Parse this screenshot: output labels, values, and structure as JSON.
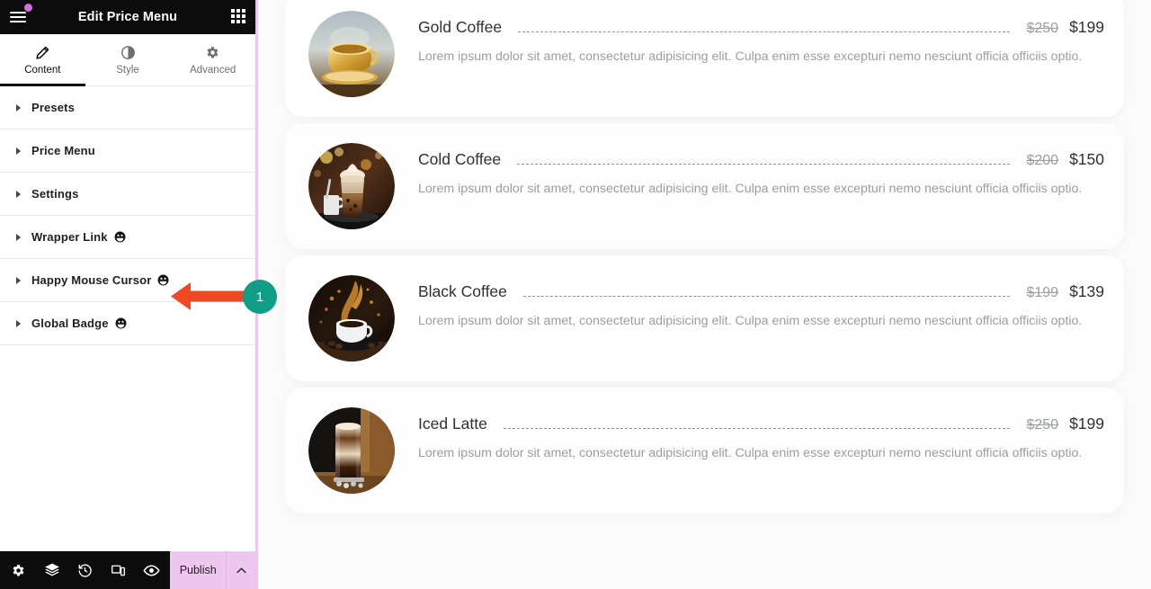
{
  "panel": {
    "header": {
      "title": "Edit Price Menu",
      "menu_icon": "hamburger-icon",
      "notification_dot": true,
      "widgets_icon": "grid-apps-icon"
    },
    "tabs": [
      {
        "label": "Content",
        "icon": "pencil-icon",
        "active": true
      },
      {
        "label": "Style",
        "icon": "contrast-half-circle-icon",
        "active": false
      },
      {
        "label": "Advanced",
        "icon": "gear-icon",
        "active": false
      }
    ],
    "sections": [
      {
        "label": "Presets",
        "pro": false
      },
      {
        "label": "Price Menu",
        "pro": false
      },
      {
        "label": "Settings",
        "pro": false
      },
      {
        "label": "Wrapper Link",
        "pro": true
      },
      {
        "label": "Happy Mouse Cursor",
        "pro": true
      },
      {
        "label": "Global Badge",
        "pro": true
      }
    ],
    "footer": {
      "tools": [
        {
          "name": "settings-gear-icon",
          "title": "Settings"
        },
        {
          "name": "layers-navigator-icon",
          "title": "Navigator"
        },
        {
          "name": "history-clock-icon",
          "title": "History"
        },
        {
          "name": "responsive-devices-icon",
          "title": "Responsive Mode"
        },
        {
          "name": "preview-eye-icon",
          "title": "Preview Changes"
        }
      ],
      "publish_label": "Publish",
      "publish_caret": "chevron-up-icon"
    }
  },
  "canvas": {
    "shared_description": "Lorem ipsum dolor sit amet, consectetur adipisicing elit. Culpa enim esse excepturi nemo nesciunt officia officiis optio.",
    "items": [
      {
        "title": "Gold Coffee",
        "price_old": "$250",
        "price_new": "$199",
        "description": "Lorem ipsum dolor sit amet, consectetur adipisicing elit. Culpa enim esse excepturi nemo nesciunt officia officiis optio.",
        "image": "gold-coffee-cup-photo"
      },
      {
        "title": "Cold Coffee",
        "price_old": "$200",
        "price_new": "$150",
        "description": "Lorem ipsum dolor sit amet, consectetur adipisicing elit. Culpa enim esse excepturi nemo nesciunt officia officiis optio.",
        "image": "cold-coffee-glass-photo"
      },
      {
        "title": "Black Coffee",
        "price_old": "$199",
        "price_new": "$139",
        "description": "Lorem ipsum dolor sit amet, consectetur adipisicing elit. Culpa enim esse excepturi nemo nesciunt officia officiis optio.",
        "image": "black-coffee-splash-photo"
      },
      {
        "title": "Iced Latte",
        "price_old": "$250",
        "price_new": "$199",
        "description": "Lorem ipsum dolor sit amet, consectetur adipisicing elit. Culpa enim esse excepturi nemo nesciunt officia officiis optio.",
        "image": "iced-latte-glass-photo"
      }
    ]
  },
  "annotation": {
    "badge_number": "1",
    "arrow_direction": "left",
    "arrow_color": "#ef4823",
    "badge_color": "#119e86",
    "points_at": "Happy Mouse Cursor"
  },
  "colors": {
    "panel_header_bg": "#0c0c0d",
    "accent_pink": "#edc7f0",
    "notification_dot": "#d76ee0",
    "text_dark": "#1d1f20",
    "text_muted": "#9a9ea0",
    "canvas_bg": "#fbfbfb"
  }
}
